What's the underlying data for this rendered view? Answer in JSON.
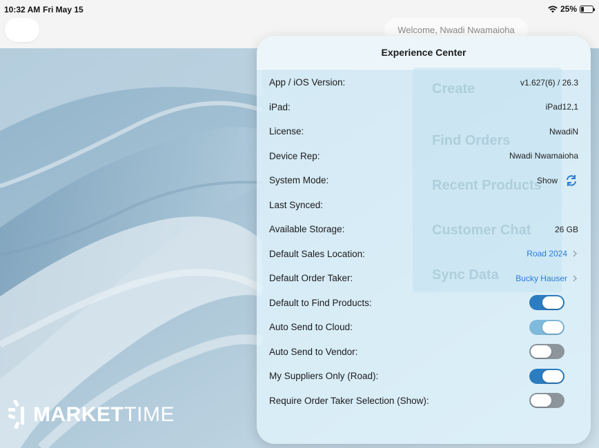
{
  "status_bar": {
    "time": "10:32 AM",
    "date": "Fri May 15",
    "battery": "25%"
  },
  "header": {
    "welcome": "Welcome, Nwadi Nwamaioha"
  },
  "logo": {
    "market": "MARKET",
    "time": "TIME"
  },
  "panel": {
    "title": "Experience Center",
    "rows": [
      {
        "label": "App / iOS Version:",
        "value": "v1.627(6) / 26.3"
      },
      {
        "label": "iPad:",
        "value": "iPad12,1"
      },
      {
        "label": "License:",
        "value": "NwadiN"
      },
      {
        "label": "Device Rep:",
        "value": "Nwadi Nwamaioha"
      },
      {
        "label": "System Mode:",
        "value": "Show"
      },
      {
        "label": "Last Synced:",
        "value": ""
      },
      {
        "label": "Available Storage:",
        "value": "26 GB"
      },
      {
        "label": "Default Sales Location:",
        "value": "Road 2024"
      },
      {
        "label": "Default Order Taker:",
        "value": "Bucky Hauser"
      }
    ],
    "toggles": [
      {
        "label": "Default to Find Products:",
        "state": "on"
      },
      {
        "label": "Auto Send to Cloud:",
        "state": "on"
      },
      {
        "label": "Auto Send to Vendor:",
        "state": "off"
      },
      {
        "label": "My Suppliers Only (Road):",
        "state": "on"
      },
      {
        "label": "Require Order Taker Selection (Show):",
        "state": "off"
      }
    ]
  },
  "colors": {
    "accent": "#2b7cc0",
    "link": "#2b7cd3",
    "toggle_off": "#8c959b",
    "panel_bg": "#dff3fb"
  }
}
